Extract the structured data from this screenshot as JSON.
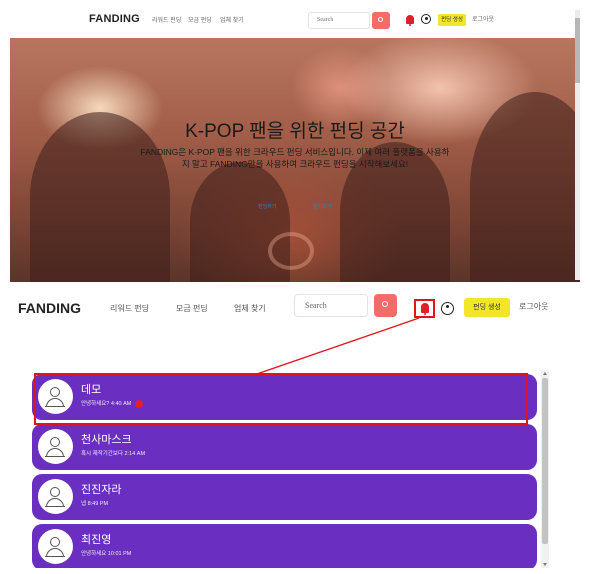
{
  "top": {
    "logo": "FANDING",
    "nav": [
      "리워드 펀딩",
      "모금 펀딩",
      "업체 찾기"
    ],
    "search_placeholder": "Search",
    "create_label": "펀딩 생성",
    "logout_label": "로그아웃",
    "hero": {
      "title": "K-POP 팬을 위한 펀딩 공간",
      "description": "FANDING은 K-POP 팬을 위한 크라우드 펀딩 서비스입니다. 이제 여러 플랫폼을 사용하지 말고 FANDING만을 사용하여 크라우드 펀딩을 시작해보세요!",
      "buttons": [
        "펀딩하기",
        "둘러보기"
      ]
    }
  },
  "bottom": {
    "logo": "FANDING",
    "nav": [
      "리워드 펀딩",
      "모금 펀딩",
      "업체 찾기"
    ],
    "search_placeholder": "Search",
    "create_label": "펀딩 생성",
    "logout_label": "로그아웃",
    "notifications": [
      {
        "name": "데모",
        "message": "안녕하세요? 4:40 AM",
        "unread": true
      },
      {
        "name": "천사마스크",
        "message": "혹시 제작기간보다 2:14 AM",
        "unread": false
      },
      {
        "name": "진진자라",
        "message": "넵 8:49 PM",
        "unread": false
      },
      {
        "name": "최진영",
        "message": "안녕하세요 10:01 PM",
        "unread": false
      }
    ]
  },
  "colors": {
    "accent_purple": "#6a2fc0",
    "highlight_red": "#e2131d",
    "create_yellow": "#f2e62a",
    "search_button": "#f36b6b"
  }
}
